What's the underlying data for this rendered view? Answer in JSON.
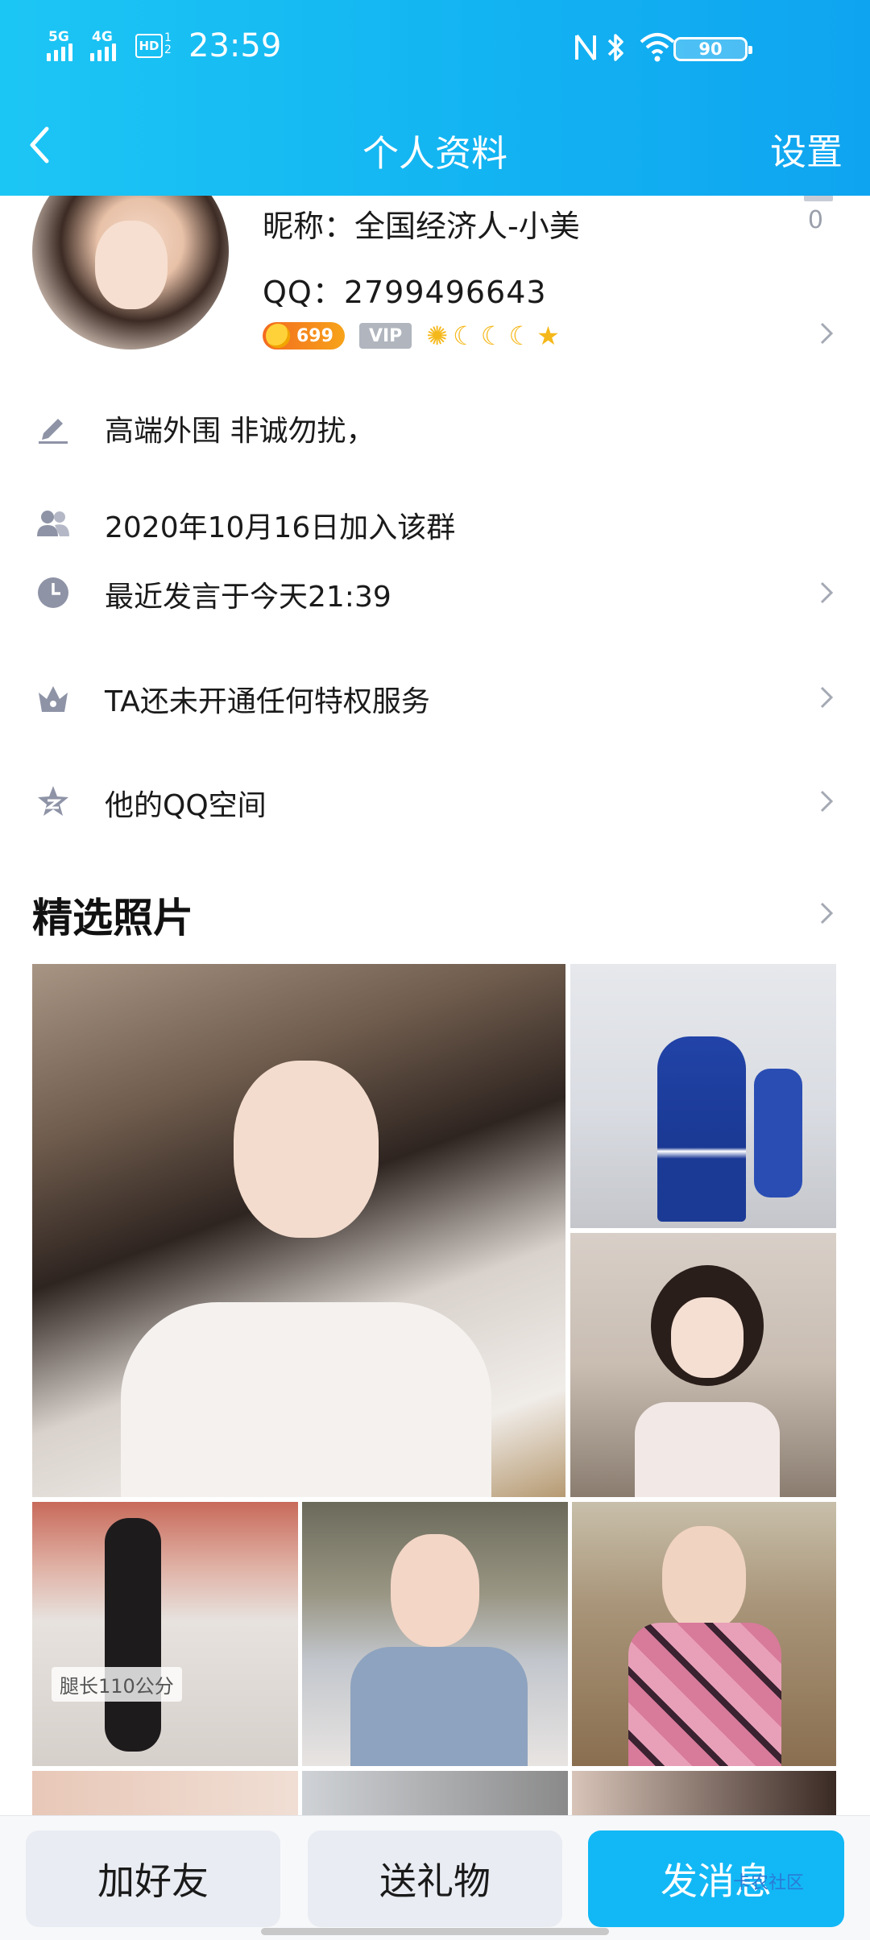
{
  "status_bar": {
    "signal1_label": "5G",
    "signal2_label": "4G",
    "hd_label": "HD",
    "hd_sub": "1 2",
    "time": "23:59",
    "battery": "90"
  },
  "nav": {
    "title": "个人资料",
    "settings": "设置"
  },
  "profile": {
    "nickname": "昵称：全国经济人-小美",
    "qq": "QQ：2799496643",
    "like_count": "0",
    "level": "699",
    "vip": "VIP"
  },
  "rows": {
    "signature": "高端外围 非诚勿扰，",
    "joined": "2020年10月16日加入该群",
    "last_speak": "最近发言于今天21:39",
    "privilege": "TA还未开通任何特权服务",
    "qzone": "他的QQ空间"
  },
  "photos": {
    "title": "精选照片",
    "caption": "腿长110公分"
  },
  "actions": {
    "add_friend": "加好友",
    "send_gift": "送礼物",
    "send_message": "发消息"
  },
  "watermark": "卡农社区",
  "colors": {
    "header": "#13b4f2",
    "primary_button": "#12b8f5",
    "icon_gray": "#8e93a6"
  }
}
